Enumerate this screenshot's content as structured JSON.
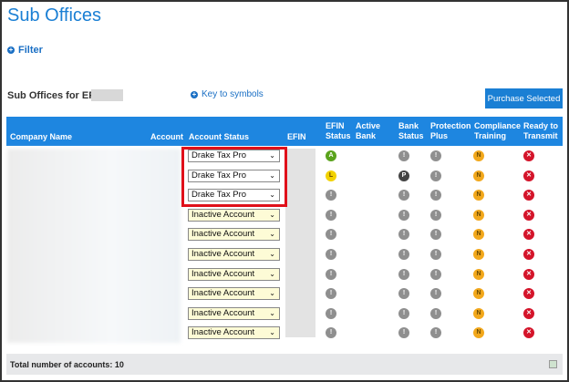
{
  "title": "Sub Offices",
  "filter_label": "Filter",
  "efin_label": "Sub Offices for EFIN:",
  "key_label": "Key to symbols",
  "purchase_label": "Purchase Selected",
  "headers": {
    "company": "Company Name",
    "account": "Account",
    "status": "Account Status",
    "efin": "EFIN",
    "efin_status": "EFIN Status",
    "active_bank": "Active Bank",
    "bank_status": "Bank Status",
    "protection": "Protection Plus",
    "compliance": "Compliance Training",
    "ready": "Ready to Transmit"
  },
  "colors": {
    "A": "#5aa31c",
    "L": "#f2d200",
    "I": "#8f8f8f",
    "P": "#444444",
    "N": "#f2a81c",
    "X": "#d4142a"
  },
  "rows": [
    {
      "status": "Drake Tax Pro",
      "efin": "A",
      "bank": "I",
      "prot": "I",
      "comp": "N",
      "ready": "X"
    },
    {
      "status": "Drake Tax Pro",
      "efin": "L",
      "bank": "P",
      "prot": "I",
      "comp": "N",
      "ready": "X"
    },
    {
      "status": "Drake Tax Pro",
      "efin": "I",
      "bank": "I",
      "prot": "I",
      "comp": "N",
      "ready": "X"
    },
    {
      "status": "Inactive Account",
      "efin": "I",
      "bank": "I",
      "prot": "I",
      "comp": "N",
      "ready": "X"
    },
    {
      "status": "Inactive Account",
      "efin": "I",
      "bank": "I",
      "prot": "I",
      "comp": "N",
      "ready": "X"
    },
    {
      "status": "Inactive Account",
      "efin": "I",
      "bank": "I",
      "prot": "I",
      "comp": "N",
      "ready": "X"
    },
    {
      "status": "Inactive Account",
      "efin": "I",
      "bank": "I",
      "prot": "I",
      "comp": "N",
      "ready": "X"
    },
    {
      "status": "Inactive Account",
      "efin": "I",
      "bank": "I",
      "prot": "I",
      "comp": "N",
      "ready": "X"
    },
    {
      "status": "Inactive Account",
      "efin": "I",
      "bank": "I",
      "prot": "I",
      "comp": "N",
      "ready": "X"
    },
    {
      "status": "Inactive Account",
      "efin": "I",
      "bank": "I",
      "prot": "I",
      "comp": "N",
      "ready": "X"
    }
  ],
  "total_label": "Total number of accounts: 10"
}
